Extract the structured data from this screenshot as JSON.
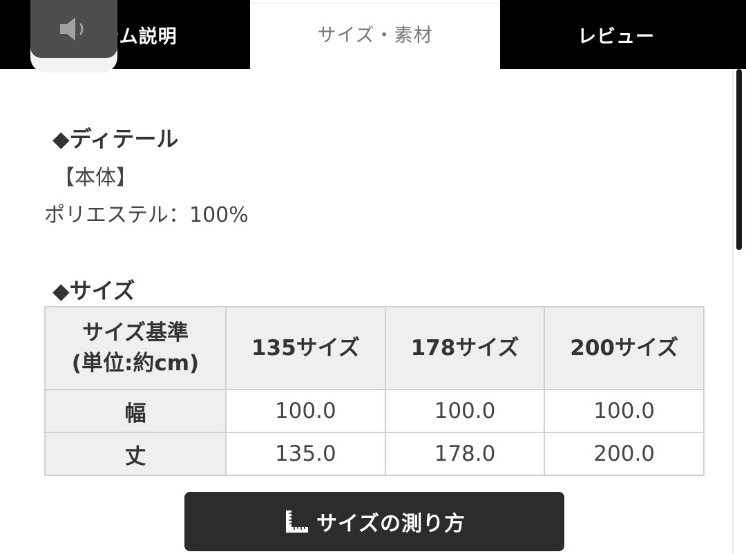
{
  "tabs": {
    "item_description": "テム説明",
    "size_material": "サイズ・素材",
    "review": "レビュー"
  },
  "overlay": {
    "icon": "speaker-icon"
  },
  "detail": {
    "heading": "◆ディテール",
    "body_label": "【本体】",
    "material": "ポリエステル：100%"
  },
  "size": {
    "heading": "◆サイズ",
    "table": {
      "corner_line1": "サイズ基準",
      "corner_line2": "(単位:約cm)",
      "columns": [
        "135サイズ",
        "178サイズ",
        "200サイズ"
      ],
      "rows": [
        {
          "label": "幅",
          "values": [
            "100.0",
            "100.0",
            "100.0"
          ]
        },
        {
          "label": "丈",
          "values": [
            "135.0",
            "178.0",
            "200.0"
          ]
        }
      ]
    }
  },
  "measure_button": {
    "label": "サイズの測り方",
    "icon": "ruler-icon"
  },
  "colors": {
    "tab_active_bg": "#000000",
    "table_header_bg": "#efefef",
    "button_bg": "#2c2c2c"
  }
}
